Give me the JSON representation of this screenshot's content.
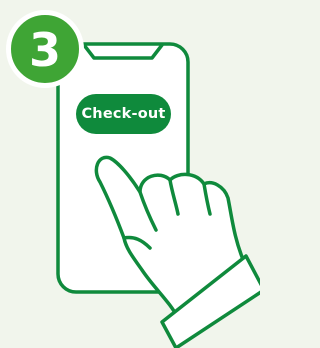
{
  "step": {
    "number": "3"
  },
  "phone": {
    "button_label": "Check-out"
  },
  "colors": {
    "background": "#f1f5ec",
    "outline": "#0f8a3c",
    "badge": "#3fa535",
    "button": "#0f8a3c",
    "button_text": "#ffffff"
  },
  "icons": [
    "smartphone-icon",
    "pointing-hand-icon"
  ]
}
